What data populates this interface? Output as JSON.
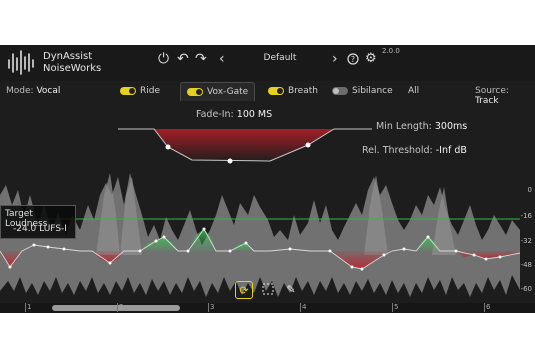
{
  "header": {
    "brand_line1": "DynAssist",
    "brand_line2": "NoiseWorks",
    "preset": "Default",
    "version": "2.0.0",
    "icons": [
      "power-icon",
      "undo-icon",
      "redo-icon",
      "chevron-left-icon",
      "chevron-right-icon",
      "help-icon",
      "gear-icon"
    ]
  },
  "modes": {
    "mode_label": "Mode:",
    "mode_value": "Vocal",
    "tabs": [
      {
        "label": "Ride",
        "enabled": true
      },
      {
        "label": "Vox-Gate",
        "enabled": true,
        "active": true
      },
      {
        "label": "Breath",
        "enabled": true
      },
      {
        "label": "Sibilance",
        "enabled": false
      },
      {
        "label": "All"
      }
    ],
    "source_label": "Source:",
    "source_value": "Track"
  },
  "gate": {
    "fade_in_label": "Fade-In:",
    "fade_in_value": "100 MS",
    "min_length_label": "Min Length:",
    "min_length_value": "300ms",
    "rel_threshold_label": "Rel. Threshold:",
    "rel_threshold_value": "-Inf dB"
  },
  "target": {
    "label": "Target Loudness",
    "value": "-24.0 LUFS-I"
  },
  "db_scale": [
    "0",
    "-16",
    "-32",
    "-48",
    "-60"
  ],
  "timeline": {
    "markers": [
      "1",
      "2",
      "3",
      "4",
      "5",
      "6"
    ]
  },
  "colors": {
    "accent": "#e6d21e",
    "target_line": "#39b54a",
    "gain_up": "#3fbf5a",
    "gain_down": "#c4202c",
    "waveform": "#8a8a8a",
    "background": "#1d1d1d"
  }
}
